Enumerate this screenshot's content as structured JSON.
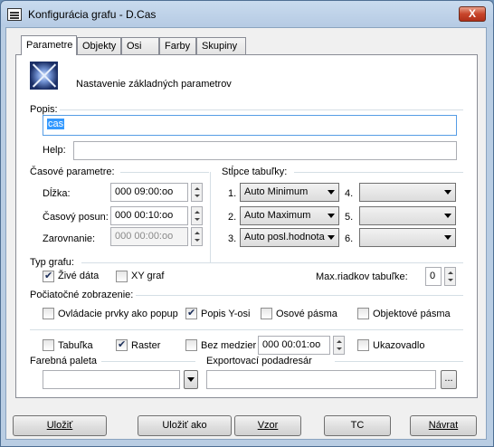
{
  "window": {
    "title": "Konfigurácia grafu -  D.Cas",
    "close_glyph": "X"
  },
  "tabs": [
    "Parametre",
    "Objekty",
    "Osi",
    "Farby",
    "Skupiny"
  ],
  "header": {
    "title": "Nastavenie základných parametrov",
    "icon": "graph-settings-icon"
  },
  "popis": {
    "label": "Popis:",
    "value": "cas"
  },
  "help": {
    "label": "Help:",
    "value": ""
  },
  "time_params": {
    "title": "Časové parametre:",
    "length": {
      "label": "Dĺžka:",
      "value": "000 09:00:oo"
    },
    "shift": {
      "label": "Časový posun:",
      "value": "000 00:10:oo"
    },
    "align": {
      "label": "Zarovnanie:",
      "value": "000 00:00:oo"
    }
  },
  "columns": {
    "title": "Stĺpce tabuľky:",
    "items": [
      {
        "num": "1.",
        "value": "Auto Minimum"
      },
      {
        "num": "2.",
        "value": "Auto Maximum"
      },
      {
        "num": "3.",
        "value": "Auto posl.hodnota"
      },
      {
        "num": "4.",
        "value": ""
      },
      {
        "num": "5.",
        "value": ""
      },
      {
        "num": "6.",
        "value": ""
      }
    ]
  },
  "graph_type": {
    "title": "Typ grafu:",
    "live_data": {
      "label": "Živé dáta",
      "checked": true
    },
    "xy_graph": {
      "label": "XY graf",
      "checked": false
    },
    "max_rows_label": "Max.riadkov tabuľke:",
    "max_rows_value": "0"
  },
  "initial_display": {
    "title": "Počiatočné zobrazenie:",
    "popup_controls": {
      "label": "Ovládacie prvky ako popup",
      "checked": false
    },
    "y_axis_label": {
      "label": "Popis Y-osi",
      "checked": true
    },
    "axis_bands": {
      "label": "Osové pásma",
      "checked": false
    },
    "object_bands": {
      "label": "Objektové pásma",
      "checked": false
    }
  },
  "options": {
    "table": {
      "label": "Tabuľka",
      "checked": false
    },
    "raster": {
      "label": "Raster",
      "checked": true
    },
    "no_gaps": {
      "label": "Bez medzier",
      "checked": false
    },
    "gap_value": "000 00:01:oo",
    "pointer": {
      "label": "Ukazovadlo",
      "checked": false
    }
  },
  "palette": {
    "label": "Farebná paleta",
    "value": ""
  },
  "export": {
    "label": "Exportovací podadresár",
    "value": "",
    "browse_label": "..."
  },
  "buttons": {
    "save": "Uložiť",
    "save_as": "Uložiť ako",
    "template": "Vzor",
    "tc": "TC",
    "back": "Návrat"
  }
}
